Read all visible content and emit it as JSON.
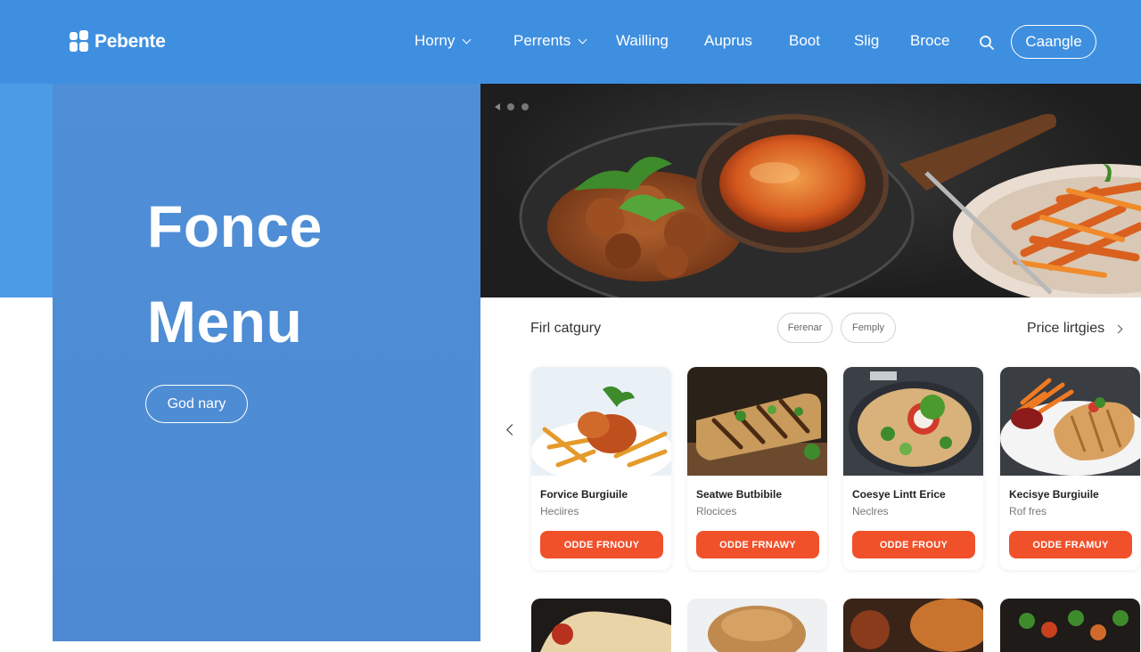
{
  "brand": {
    "name": "Pebente",
    "icon": "grid-logo-icon"
  },
  "nav": {
    "items": [
      {
        "label": "Horny",
        "dropdown": true
      },
      {
        "label": "Perrents",
        "dropdown": true
      },
      {
        "label": "Wailling",
        "dropdown": false
      },
      {
        "label": "Auprus",
        "dropdown": false
      },
      {
        "label": "Boot",
        "dropdown": false
      },
      {
        "label": "Slig",
        "dropdown": false
      },
      {
        "label": "Broce",
        "dropdown": false
      }
    ],
    "search_icon": "search-icon",
    "cta_label": "Caangle"
  },
  "hero": {
    "title_line1": "Fonce",
    "title_line2": "Menu",
    "button_label": "God nary"
  },
  "filters": {
    "title": "Firl catgury",
    "chips": [
      "Ferenar",
      "Femply"
    ],
    "price_label": "Price lirtgies"
  },
  "cards": [
    {
      "name": "Forvice Burgiuile",
      "sub": "Heciires",
      "button": "ODDE FRNOUY"
    },
    {
      "name": "Seatwe Butbibile",
      "sub": "Rlocices",
      "button": "ODDE FRNAWY"
    },
    {
      "name": "Coesye Lintt Erice",
      "sub": "Neclres",
      "button": "ODDE FROUY"
    },
    {
      "name": "Kecisye Burgiuile",
      "sub": "Rof fres",
      "button": "ODDE FRAMUY"
    }
  ],
  "colors": {
    "header_bg": "#3f8fe0",
    "hero_bg": "#4e8ad2",
    "accent_button": "#f0512b"
  }
}
